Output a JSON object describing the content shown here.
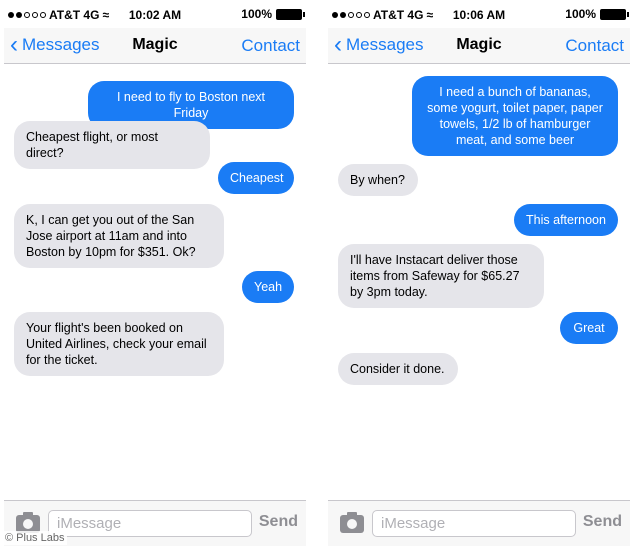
{
  "phones": [
    {
      "status": {
        "carrier": "AT&T 4G",
        "time": "10:02 AM",
        "battery": "100%"
      },
      "nav": {
        "back": "Messages",
        "title": "Magic",
        "contact": "Contact"
      },
      "messages": [
        {
          "from": "out",
          "text": "I need to fly to Boston next Friday"
        },
        {
          "from": "in",
          "text": "Cheapest flight, or most direct?"
        },
        {
          "from": "out",
          "text": "Cheapest"
        },
        {
          "from": "in",
          "text": "K, I can get you out of the San Jose airport at 11am and into Boston by 10pm for $351. Ok?"
        },
        {
          "from": "out",
          "text": "Yeah"
        },
        {
          "from": "in",
          "text": "Your flight's been booked on United Airlines, check your email for the ticket."
        }
      ],
      "input": {
        "placeholder": "iMessage",
        "send": "Send"
      }
    },
    {
      "status": {
        "carrier": "AT&T 4G",
        "time": "10:06 AM",
        "battery": "100%"
      },
      "nav": {
        "back": "Messages",
        "title": "Magic",
        "contact": "Contact"
      },
      "messages": [
        {
          "from": "out",
          "text": "I need a bunch of bananas, some yogurt, toilet paper, paper towels, 1/2 lb of hamburger meat, and some beer"
        },
        {
          "from": "in",
          "text": "By when?"
        },
        {
          "from": "out",
          "text": "This afternoon"
        },
        {
          "from": "in",
          "text": "I'll have Instacart deliver those items from Safeway for $65.27 by 3pm today."
        },
        {
          "from": "out",
          "text": "Great"
        },
        {
          "from": "in",
          "text": "Consider it done."
        }
      ],
      "input": {
        "placeholder": "iMessage",
        "send": "Send"
      }
    }
  ],
  "credit": "© Plus Labs"
}
